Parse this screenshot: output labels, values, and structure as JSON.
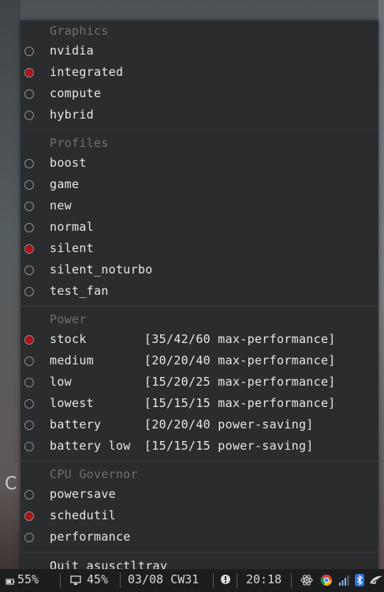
{
  "menu": {
    "sections": [
      {
        "header": "Graphics",
        "items": [
          {
            "label": "nvidia",
            "checked": false
          },
          {
            "label": "integrated",
            "checked": true
          },
          {
            "label": "compute",
            "checked": false
          },
          {
            "label": "hybrid",
            "checked": false
          }
        ]
      },
      {
        "header": "Profiles",
        "items": [
          {
            "label": "boost",
            "checked": false
          },
          {
            "label": "game",
            "checked": false
          },
          {
            "label": "new",
            "checked": false
          },
          {
            "label": "normal",
            "checked": false
          },
          {
            "label": "silent",
            "checked": true
          },
          {
            "label": "silent_noturbo",
            "checked": false
          },
          {
            "label": "test_fan",
            "checked": false
          }
        ]
      },
      {
        "header": "Power",
        "items": [
          {
            "label": "stock",
            "detail": "[35/42/60 max-performance]",
            "checked": true
          },
          {
            "label": "medium",
            "detail": "[20/20/40 max-performance]",
            "checked": false
          },
          {
            "label": "low",
            "detail": "[15/20/25 max-performance]",
            "checked": false
          },
          {
            "label": "lowest",
            "detail": "[15/15/15 max-performance]",
            "checked": false
          },
          {
            "label": "battery",
            "detail": "[20/20/40 power-saving]",
            "checked": false
          },
          {
            "label": "battery low",
            "detail": "[15/15/15 power-saving]",
            "checked": false
          }
        ]
      },
      {
        "header": "CPU Governor",
        "items": [
          {
            "label": "powersave",
            "checked": false
          },
          {
            "label": "schedutil",
            "checked": true
          },
          {
            "label": "performance",
            "checked": false
          }
        ]
      }
    ],
    "quit_label": "Quit asusctltray"
  },
  "taskbar": {
    "battery": "55%",
    "brightness": "45%",
    "date": "03/08 CW31",
    "time": "20:18"
  },
  "colors": {
    "menu_bg": "#2b2c2e",
    "header_text": "#6e7072",
    "item_text": "#e6e6e6",
    "checked_radio": "#c4121b",
    "taskbar_bg": "#1c1d1f"
  }
}
